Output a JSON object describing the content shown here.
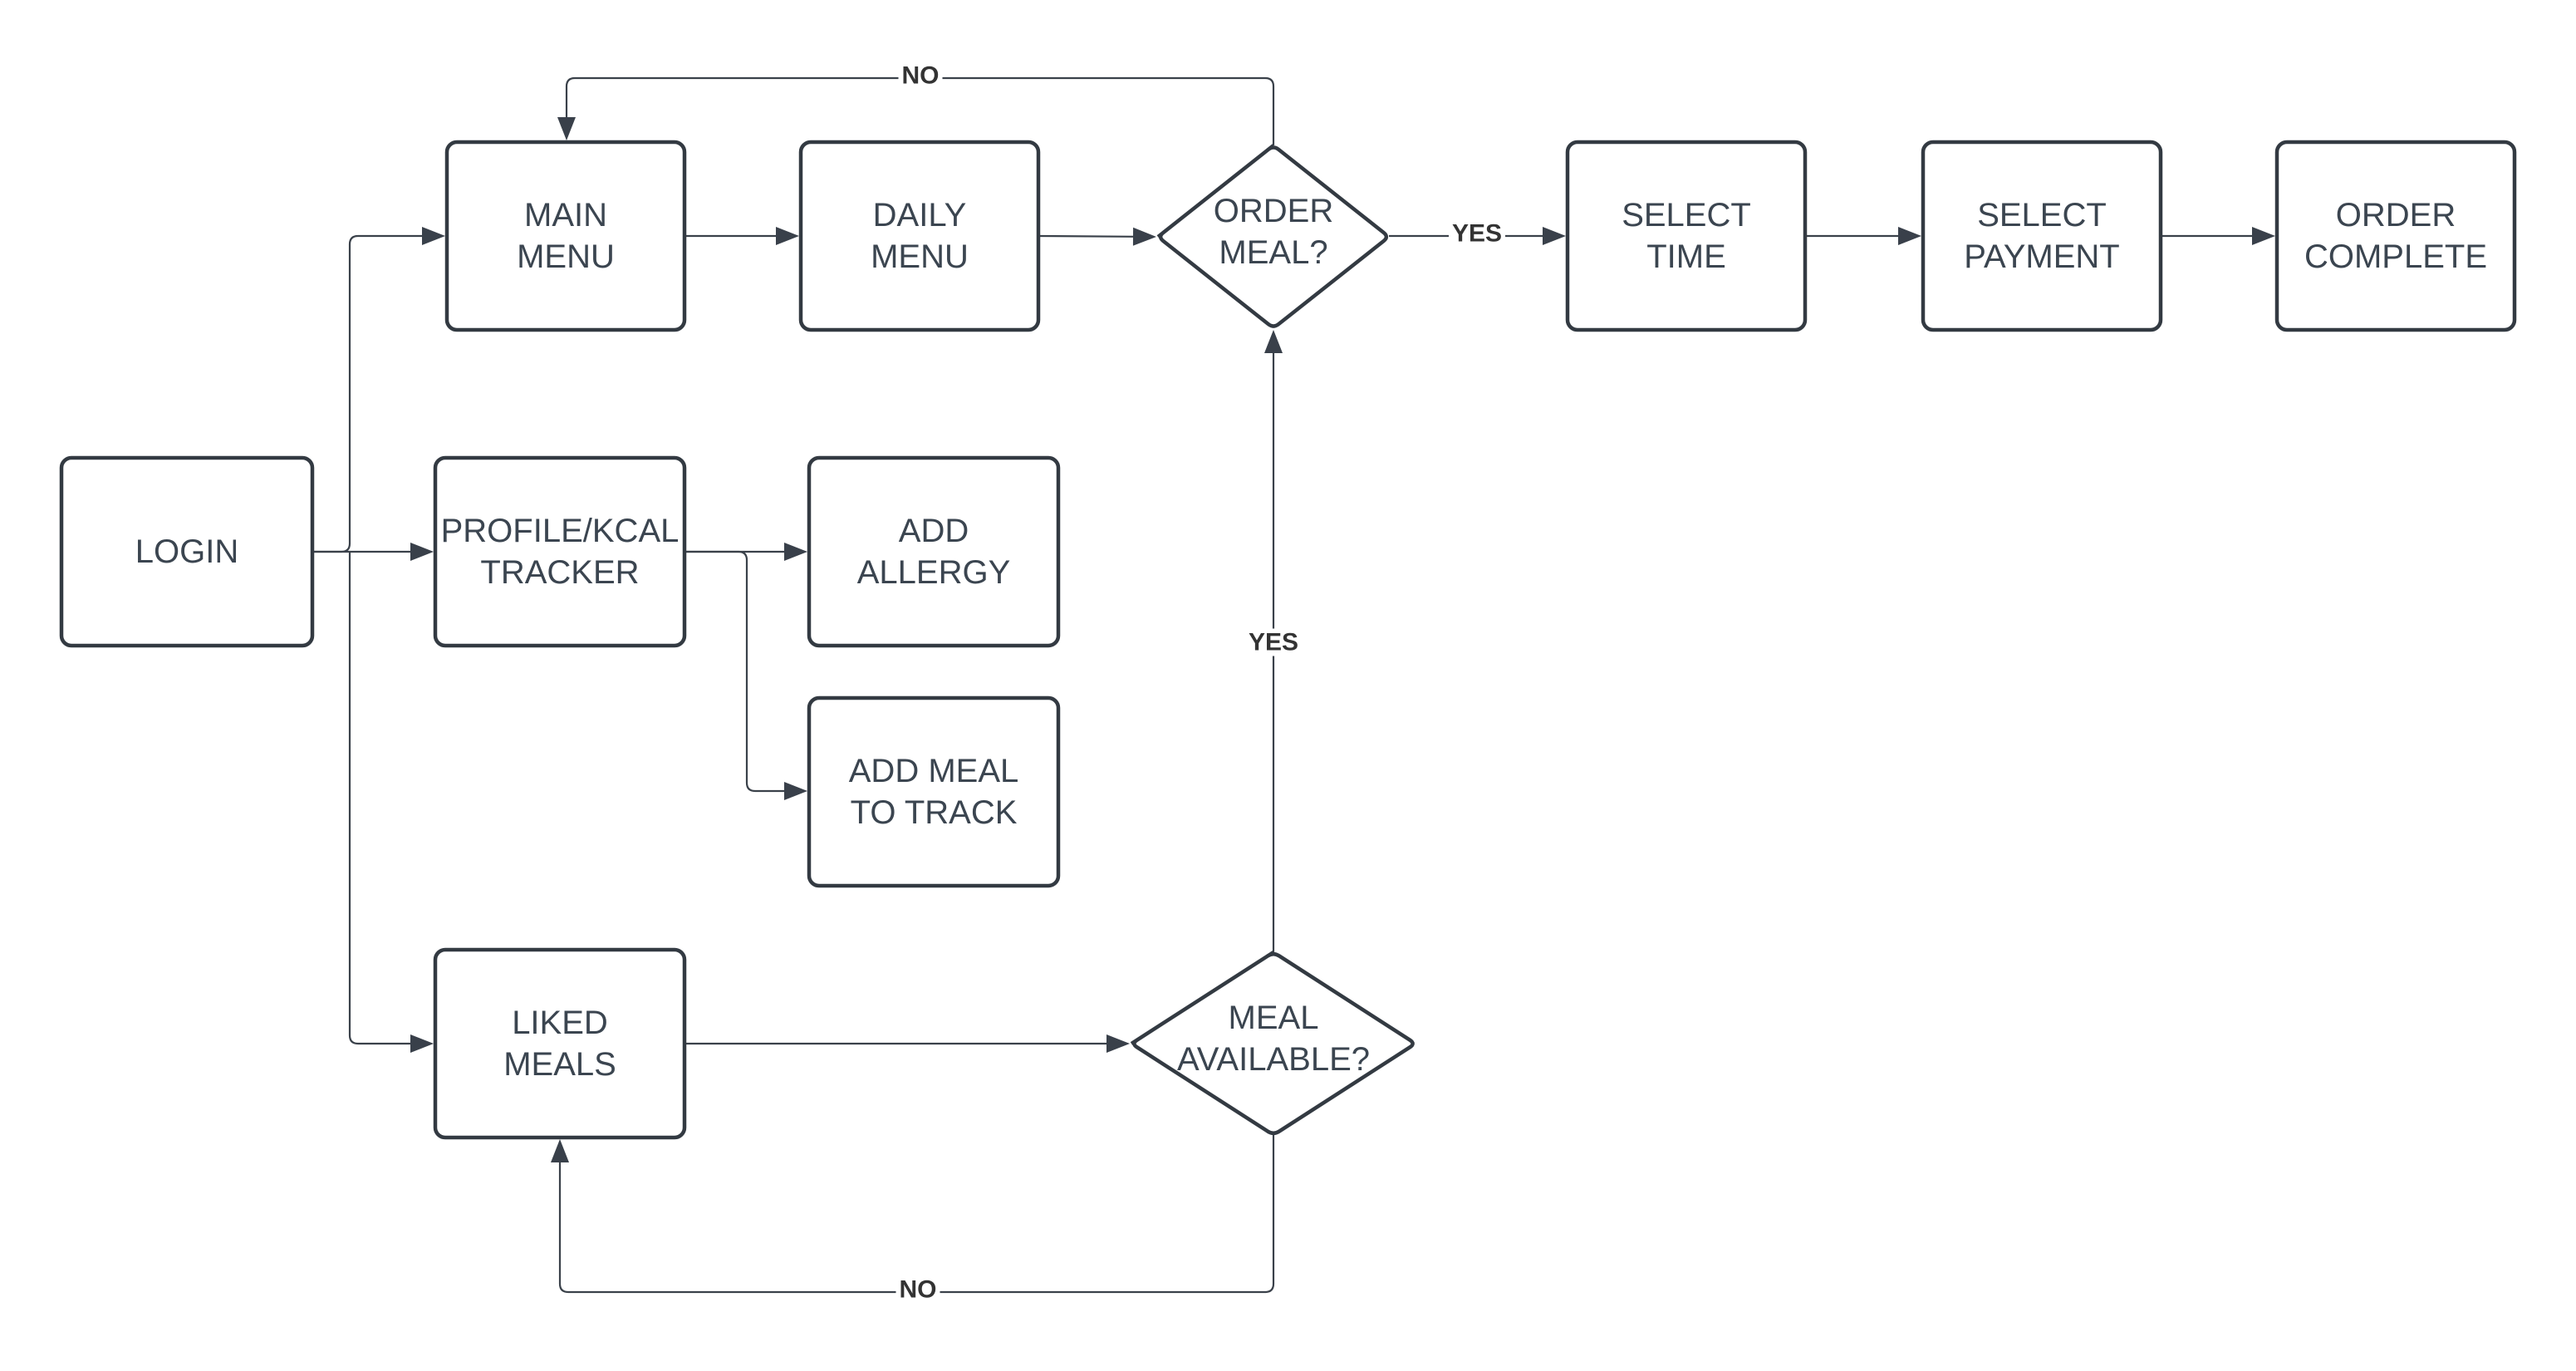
{
  "diagram": {
    "type": "flowchart",
    "nodes": [
      {
        "id": "login",
        "shape": "process",
        "lines": [
          "LOGIN"
        ]
      },
      {
        "id": "main-menu",
        "shape": "process",
        "lines": [
          "MAIN",
          "MENU"
        ]
      },
      {
        "id": "daily-menu",
        "shape": "process",
        "lines": [
          "DAILY",
          "MENU"
        ]
      },
      {
        "id": "order-meal",
        "shape": "decision",
        "lines": [
          "ORDER",
          "MEAL?"
        ]
      },
      {
        "id": "select-time",
        "shape": "process",
        "lines": [
          "SELECT",
          "TIME"
        ]
      },
      {
        "id": "select-payment",
        "shape": "process",
        "lines": [
          "SELECT",
          "PAYMENT"
        ]
      },
      {
        "id": "order-complete",
        "shape": "process",
        "lines": [
          "ORDER",
          "COMPLETE"
        ]
      },
      {
        "id": "profile-kcal-tracker",
        "shape": "process",
        "lines": [
          "PROFILE/KCAL",
          "TRACKER"
        ]
      },
      {
        "id": "add-allergy",
        "shape": "process",
        "lines": [
          "ADD",
          "ALLERGY"
        ]
      },
      {
        "id": "add-meal-to-track",
        "shape": "process",
        "lines": [
          "ADD MEAL",
          "TO TRACK"
        ]
      },
      {
        "id": "liked-meals",
        "shape": "process",
        "lines": [
          "LIKED",
          "MEALS"
        ]
      },
      {
        "id": "meal-available",
        "shape": "decision",
        "lines": [
          "MEAL",
          "AVAILABLE?"
        ]
      }
    ],
    "edges": [
      {
        "id": "login-to-main-menu",
        "from": "login",
        "to": "main-menu",
        "label": ""
      },
      {
        "id": "login-to-profile",
        "from": "login",
        "to": "profile-kcal-tracker",
        "label": ""
      },
      {
        "id": "login-to-liked-meals",
        "from": "login",
        "to": "liked-meals",
        "label": ""
      },
      {
        "id": "main-menu-to-daily-menu",
        "from": "main-menu",
        "to": "daily-menu",
        "label": ""
      },
      {
        "id": "daily-menu-to-order-meal",
        "from": "daily-menu",
        "to": "order-meal",
        "label": ""
      },
      {
        "id": "order-meal-no",
        "from": "order-meal",
        "to": "main-menu",
        "label": "NO"
      },
      {
        "id": "order-meal-yes",
        "from": "order-meal",
        "to": "select-time",
        "label": "YES"
      },
      {
        "id": "select-time-to-payment",
        "from": "select-time",
        "to": "select-payment",
        "label": ""
      },
      {
        "id": "payment-to-complete",
        "from": "select-payment",
        "to": "order-complete",
        "label": ""
      },
      {
        "id": "profile-to-add-allergy",
        "from": "profile-kcal-tracker",
        "to": "add-allergy",
        "label": ""
      },
      {
        "id": "profile-to-add-meal",
        "from": "profile-kcal-tracker",
        "to": "add-meal-to-track",
        "label": ""
      },
      {
        "id": "liked-meals-to-meal-available",
        "from": "liked-meals",
        "to": "meal-available",
        "label": ""
      },
      {
        "id": "meal-available-yes",
        "from": "meal-available",
        "to": "order-meal",
        "label": "YES"
      },
      {
        "id": "meal-available-no",
        "from": "meal-available",
        "to": "liked-meals",
        "label": "NO"
      }
    ]
  }
}
